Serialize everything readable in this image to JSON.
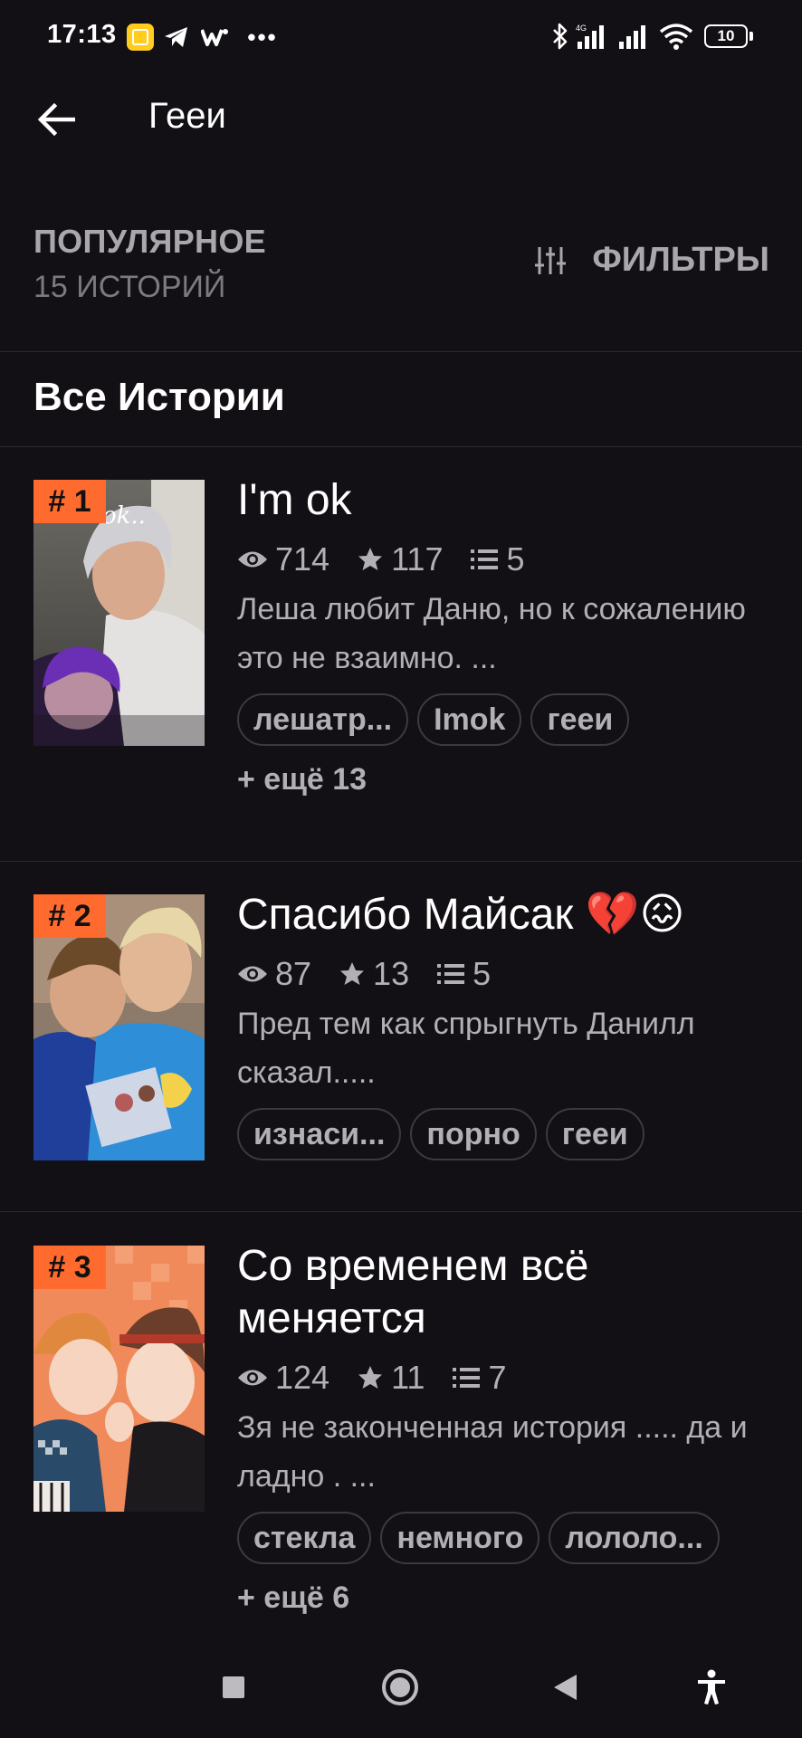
{
  "status_bar": {
    "time": "17:13",
    "battery": "10",
    "overflow": "•••"
  },
  "app_bar": {
    "title": "Гееи"
  },
  "sort": {
    "label": "ПОПУЛЯРНОЕ",
    "count": "15 ИСТОРИЙ",
    "filter_label": "ФИЛЬТРЫ"
  },
  "section": {
    "title": "Все Истории"
  },
  "stories": [
    {
      "rank": "# 1",
      "title": "I'm ok",
      "views": "714",
      "stars": "117",
      "chapters": "5",
      "description": "Леша любит Даню, но к сожалению это не взаимно. ...",
      "tags": [
        "лешатр...",
        "Imok",
        "гееи"
      ],
      "more": "+ ещё 13",
      "cover_text": "ok.."
    },
    {
      "rank": "# 2",
      "title": "Спасибо Майсак 💔😖",
      "views": "87",
      "stars": "13",
      "chapters": "5",
      "description": "Пред тем как спрыгнуть Данилл сказал.....",
      "tags": [
        "изнаси...",
        "порно",
        "гееи"
      ],
      "more": ""
    },
    {
      "rank": "# 3",
      "title": "Со временем всё меняется",
      "views": "124",
      "stars": "11",
      "chapters": "7",
      "description": "Зя не законченная история ..... да и ладно . ...",
      "tags": [
        "стекла",
        "немного",
        "лололо..."
      ],
      "more": "+ ещё 6"
    }
  ],
  "colors": {
    "background": "#121014",
    "rank_badge": "#ff6b2f",
    "muted_text": "#b2b0b5",
    "divider": "#2c2a2e"
  }
}
